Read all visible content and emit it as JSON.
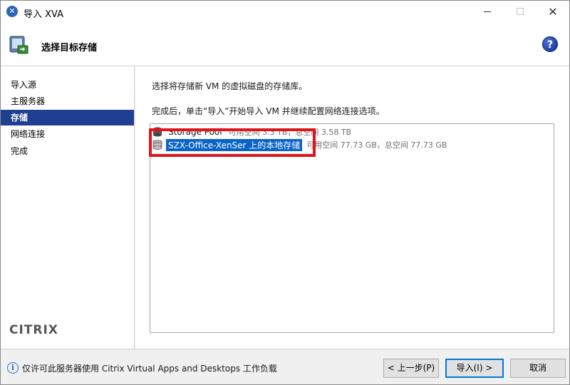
{
  "window": {
    "title": "导入 XVA",
    "icon": "xenserver-app-icon"
  },
  "header": {
    "title": "选择目标存储",
    "icon": "storage-wizard-icon",
    "help_symbol": "?"
  },
  "sidebar": {
    "items": [
      {
        "label": "导入源",
        "active": false
      },
      {
        "label": "主服务器",
        "active": false
      },
      {
        "label": "存储",
        "active": true
      },
      {
        "label": "网络连接",
        "active": false
      },
      {
        "label": "完成",
        "active": false
      }
    ],
    "logo_text": "CITRIX"
  },
  "main": {
    "description_1": "选择将存储新 VM 的虚拟磁盘的存储库。",
    "description_2": "完成后，单击“导入”开始导入 VM 并继续配置网络连接选项。",
    "storage_repositories": [
      {
        "name": "Storage Pool",
        "detail": "可用空间 3.3 TB，总空间 3.58 TB",
        "selected": false
      },
      {
        "name": "SZX-Office-XenSer 上的本地存储",
        "detail": "可用空间 77.73 GB，总空间 77.73 GB",
        "selected": true
      }
    ]
  },
  "footer": {
    "note": "仅许可此服务器使用 Citrix Virtual Apps and Desktops 工作负载",
    "back_label": "< 上一步(P)",
    "next_label": "导入(I) >",
    "cancel_label": "取消"
  },
  "colors": {
    "selection": "#0a64c8",
    "active_nav": "#1f3f91",
    "annotation_box": "#e2141b"
  }
}
